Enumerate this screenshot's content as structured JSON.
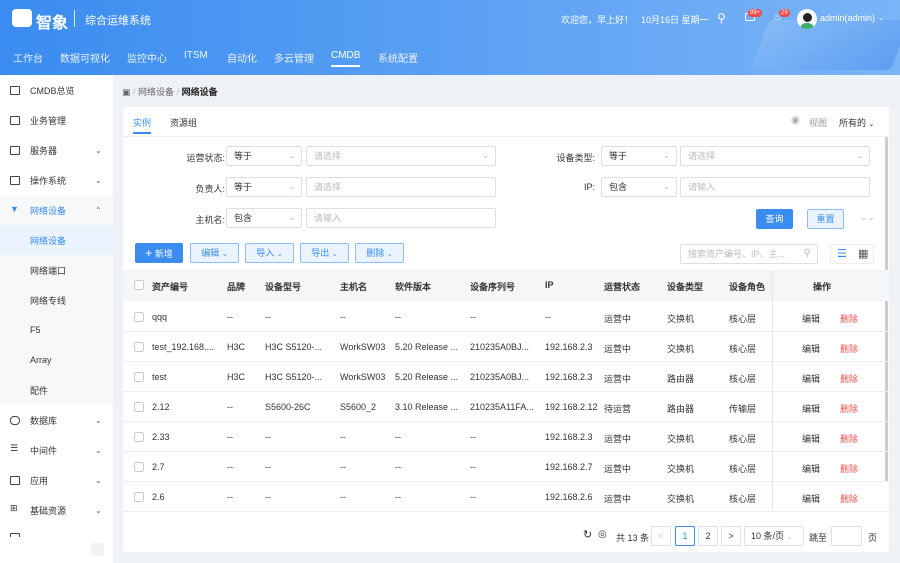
{
  "header": {
    "brand": "智象",
    "system_name": "综合运维系统",
    "greeting": "欢迎您，早上好！",
    "date": "10月16日 星期一",
    "mail_badge": "99+",
    "bell_badge": "29",
    "user": "admin(admin)",
    "nav": [
      "工作台",
      "数据可视化",
      "监控中心",
      "ITSM",
      "自动化",
      "多云管理",
      "CMDB",
      "系统配置"
    ],
    "active_nav": "CMDB"
  },
  "sidebar": {
    "items": [
      {
        "label": "CMDB总览",
        "icon": "chart-icon"
      },
      {
        "label": "业务管理",
        "icon": "document-icon"
      },
      {
        "label": "服务器",
        "icon": "server-icon"
      },
      {
        "label": "操作系统",
        "icon": "monitor-icon"
      },
      {
        "label": "网络设备",
        "icon": "network-icon"
      },
      {
        "label": "网络设备"
      },
      {
        "label": "网络端口"
      },
      {
        "label": "网络专线"
      },
      {
        "label": "F5"
      },
      {
        "label": "Array"
      },
      {
        "label": "配件"
      },
      {
        "label": "数据库",
        "icon": "database-icon"
      },
      {
        "label": "中间件",
        "icon": "middleware-icon"
      },
      {
        "label": "应用",
        "icon": "app-icon"
      },
      {
        "label": "基础资源",
        "icon": "grid-icon"
      },
      {
        "label": "...",
        "icon": "more-icon"
      }
    ]
  },
  "breadcrumb": [
    "网络设备",
    "网络设备"
  ],
  "tabs": [
    "实例",
    "资源组"
  ],
  "view": {
    "label": "视图",
    "scope": "所有的"
  },
  "filters": {
    "status": {
      "label": "运营状态:",
      "op": "等于",
      "placeholder": "请选择"
    },
    "owner": {
      "label": "负责人:",
      "op": "等于",
      "placeholder": "请选择"
    },
    "hostname": {
      "label": "主机名:",
      "op": "包含",
      "placeholder": "请输入"
    },
    "device_type": {
      "label": "设备类型:",
      "op": "等于",
      "placeholder": "请选择"
    },
    "ip": {
      "label": "IP:",
      "op": "包含",
      "placeholder": "请输入"
    },
    "query": "查询",
    "reset": "重置"
  },
  "toolbar": {
    "add": "新增",
    "edit": "编辑",
    "import": "导入",
    "export": "导出",
    "delete": "删除",
    "search_placeholder": "搜索资产编号、IP、主..."
  },
  "table": {
    "columns": [
      "资产编号",
      "品牌",
      "设备型号",
      "主机名",
      "软件版本",
      "设备序列号",
      "IP",
      "运营状态",
      "设备类型",
      "设备角色",
      "操作"
    ],
    "rows": [
      [
        "qqq",
        "--",
        "--",
        "--",
        "--",
        "--",
        "--",
        "运营中",
        "交换机",
        "核心层"
      ],
      [
        "test_192.168....",
        "H3C",
        "H3C S5120-...",
        "WorkSW03",
        "5.20 Release ...",
        "210235A0BJ...",
        "192.168.2.3",
        "运营中",
        "交换机",
        "核心层"
      ],
      [
        "test",
        "H3C",
        "H3C S5120-...",
        "WorkSW03",
        "5.20 Release ...",
        "210235A0BJ...",
        "192.168.2.3",
        "运营中",
        "路由器",
        "核心层"
      ],
      [
        "2.12",
        "--",
        "S5600-26C",
        "S5600_2",
        "3.10 Release ...",
        "210235A11FA...",
        "192.168.2.12",
        "待运营",
        "路由器",
        "传输层"
      ],
      [
        "2.33",
        "--",
        "--",
        "--",
        "--",
        "--",
        "192.168.2.3",
        "运营中",
        "交换机",
        "核心层"
      ],
      [
        "2.7",
        "--",
        "--",
        "--",
        "--",
        "--",
        "192.168.2.7",
        "运营中",
        "交换机",
        "核心层"
      ],
      [
        "2.6",
        "--",
        "--",
        "--",
        "--",
        "--",
        "192.168.2.6",
        "运营中",
        "交换机",
        "核心层"
      ]
    ],
    "edit": "编辑",
    "delete": "删除"
  },
  "pagination": {
    "total": "共 13 条",
    "pages": [
      "1",
      "2"
    ],
    "current": "1",
    "page_size": "10 条/页",
    "jump": "跳至",
    "page_unit": "页"
  },
  "colors": {
    "primary": "#3a8cf0",
    "danger": "#f05050"
  }
}
